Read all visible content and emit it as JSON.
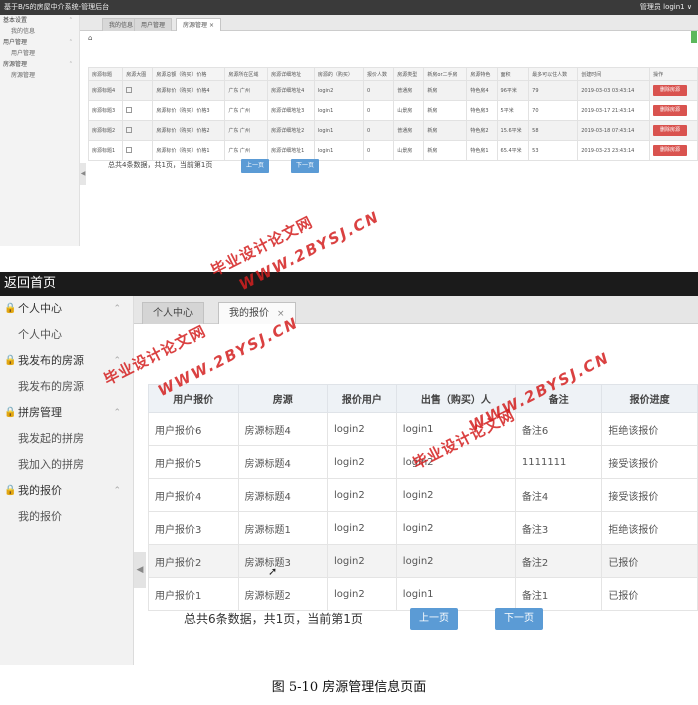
{
  "shot1": {
    "window_title": "基于B/S的房屋中介系统-管理后台",
    "user_menu": "管理员  login1 ∨",
    "sidebar": [
      {
        "group": "基本设置",
        "items": [
          "我的信息"
        ]
      },
      {
        "group": "用户管理",
        "items": [
          "用户管理"
        ]
      },
      {
        "group": "房源管理",
        "items": [
          "房源管理"
        ]
      }
    ],
    "tabs": [
      {
        "label": "我的信息"
      },
      {
        "label": "用户管理"
      },
      {
        "label": "房源管理"
      }
    ],
    "home_icon": "⌂",
    "columns": [
      "房源标题",
      "房源大图",
      "房源总额（购买）价格",
      "房源所在区域",
      "房源详细地址",
      "房源的（购买）",
      "报价人数",
      "房源类型",
      "新房or二手房",
      "房源特色",
      "面积",
      "最多可以住人数",
      "创建时间",
      "操作"
    ],
    "rows": [
      [
        "房源标题4",
        "",
        "房源标价（购买）价格4",
        "广东 广州",
        "房源详细地址4",
        "login2",
        "0",
        "普通房",
        "新房",
        "特色房4",
        "96平米",
        "79",
        "2019-03-03 03:43:14",
        "删除房源"
      ],
      [
        "房源标题3",
        "",
        "房源标价（购买）价格3",
        "广东 广州",
        "房源详细地址3",
        "login1",
        "0",
        "山景房",
        "新房",
        "特色房3",
        "5平米",
        "70",
        "2019-03-17 21:43:14",
        "删除房源"
      ],
      [
        "房源标题2",
        "",
        "房源标价（购买）价格2",
        "广东 广州",
        "房源详细地址2",
        "login1",
        "0",
        "普通房",
        "新房",
        "特色房2",
        "15.6平米",
        "58",
        "2019-03-18 07:43:14",
        "删除房源"
      ],
      [
        "房源标题1",
        "",
        "房源标价（购买）价格1",
        "广东 广州",
        "房源详细地址1",
        "login1",
        "0",
        "山景房",
        "新房",
        "特色房1",
        "65.4平米",
        "53",
        "2019-03-23 23:43:14",
        "删除房源"
      ]
    ],
    "pagination_text": "总共4条数据，共1页，当前第1页",
    "prev_label": "上一页",
    "next_label": "下一页"
  },
  "shot2": {
    "back_title": "返回首页",
    "sidebar": [
      {
        "group": "个人中心",
        "items": [
          "个人中心"
        ]
      },
      {
        "group": "我发布的房源",
        "items": [
          "我发布的房源"
        ]
      },
      {
        "group": "拼房管理",
        "items": [
          "我发起的拼房",
          "我加入的拼房"
        ]
      },
      {
        "group": "我的报价",
        "items": [
          "我的报价"
        ]
      }
    ],
    "tabs": [
      {
        "label": "个人中心"
      },
      {
        "label": "我的报价"
      }
    ],
    "columns": [
      "用户报价",
      "房源",
      "报价用户",
      "出售（购买）人",
      "备注",
      "报价进度"
    ],
    "rows": [
      [
        "用户报价6",
        "房源标题4",
        "login2",
        "login1",
        "备注6",
        "拒绝该报价"
      ],
      [
        "用户报价5",
        "房源标题4",
        "login2",
        "login2",
        "1111111",
        "接受该报价"
      ],
      [
        "用户报价4",
        "房源标题4",
        "login2",
        "login2",
        "备注4",
        "接受该报价"
      ],
      [
        "用户报价3",
        "房源标题1",
        "login2",
        "login2",
        "备注3",
        "拒绝该报价"
      ],
      [
        "用户报价2",
        "房源标题3",
        "login2",
        "login2",
        "备注2",
        "已报价"
      ],
      [
        "用户报价1",
        "房源标题2",
        "login2",
        "login1",
        "备注1",
        "已报价"
      ]
    ],
    "pagination_text": "总共6条数据，共1页，当前第1页",
    "prev_label": "上一页",
    "next_label": "下一页"
  },
  "watermark": {
    "line1": "毕业设计论文网",
    "line2": "WWW.2BYSJ.CN"
  },
  "caption": "图 5-10 房源管理信息页面",
  "colors": {
    "delete_button": "#d9534f",
    "page_button": "#5b9bd5",
    "watermark": "#d42020"
  }
}
